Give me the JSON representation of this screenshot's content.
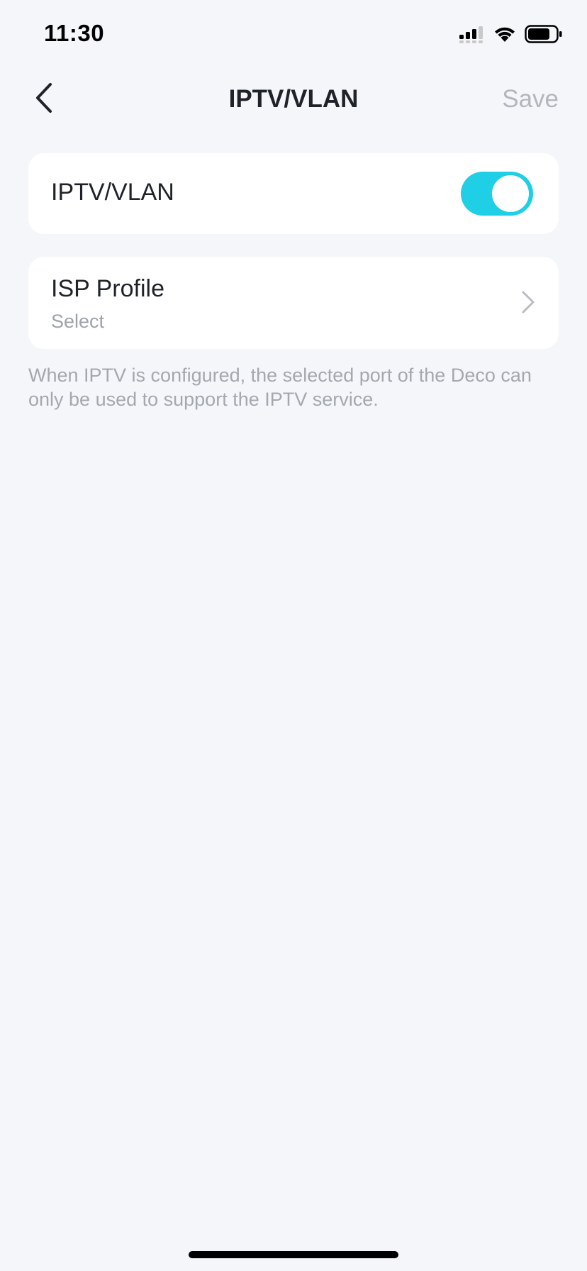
{
  "status_bar": {
    "time": "11:30",
    "icons": [
      "cellular-signal-icon",
      "wifi-icon",
      "battery-icon"
    ]
  },
  "nav": {
    "title": "IPTV/VLAN",
    "save_label": "Save",
    "back_icon": "chevron-left-icon"
  },
  "iptv_toggle": {
    "label": "IPTV/VLAN",
    "enabled": true
  },
  "isp_profile": {
    "label": "ISP Profile",
    "value": "Select",
    "icon": "chevron-right-icon"
  },
  "note": "When IPTV is configured, the selected port of the Deco can only be used to support the IPTV service.",
  "colors": {
    "background": "#f4f6fa",
    "toggle_on": "#1ecfe5",
    "card": "#ffffff",
    "muted_text": "#a4a8ae",
    "save_disabled": "#b3b7bd"
  }
}
